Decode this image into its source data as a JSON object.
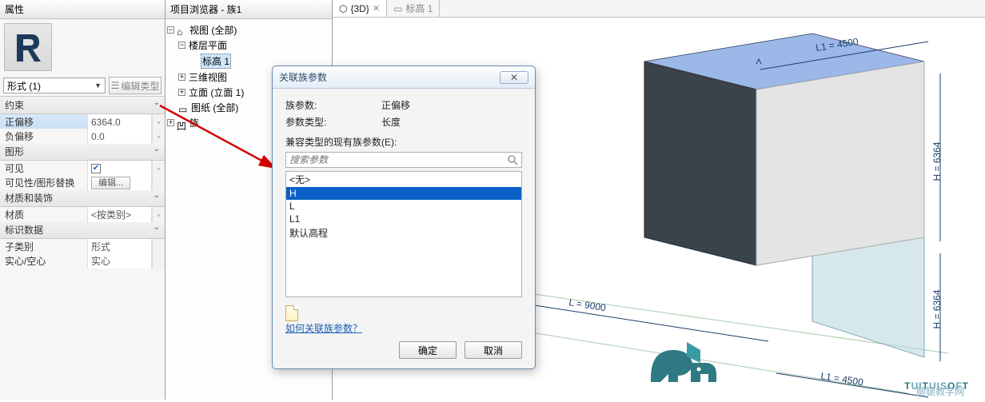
{
  "props": {
    "title": "属性",
    "type_selector": "形式 (1)",
    "edit_type": "编辑类型",
    "groups": {
      "constraint": "约束",
      "graphics": "图形",
      "material": "材质和装饰",
      "identity": "标识数据"
    },
    "rows": {
      "pos_offset_l": "正偏移",
      "pos_offset_v": "6364.0",
      "neg_offset_l": "负偏移",
      "neg_offset_v": "0.0",
      "visible_l": "可见",
      "override_l": "可见性/图形替换",
      "override_v": "编辑...",
      "material_l": "材质",
      "material_v": "<按类别>",
      "subcat_l": "子类别",
      "subcat_v": "形式",
      "solid_l": "实心/空心",
      "solid_v": "实心"
    }
  },
  "browser": {
    "title": "项目浏览器 - 族1",
    "items": {
      "views": "视图 (全部)",
      "floor": "楼层平面",
      "level1": "标高 1",
      "threeD": "三维视图",
      "elev": "立面 (立面 1)",
      "sheets": "图纸 (全部)",
      "family": "族"
    }
  },
  "tabs": {
    "t1": "{3D}",
    "t2": "标高 1"
  },
  "dialog": {
    "title": "关联族参数",
    "row1_l": "族参数:",
    "row1_v": "正偏移",
    "row2_l": "参数类型:",
    "row2_v": "长度",
    "list_label": "兼容类型的现有族参数(E):",
    "search_ph": "搜索参数",
    "items": {
      "none": "<无>",
      "h": "H",
      "l": "L",
      "l1": "L1",
      "elev": "默认高程"
    },
    "help": "如何关联族参数？",
    "ok": "确定",
    "cancel": "取消"
  },
  "dims": {
    "l1_top": "L1 = 4500",
    "l_bottom": "L = 9000",
    "h_right1": "H = 6364",
    "h_right2": "H = 6364",
    "l1_bottom": "L1 = 4500"
  },
  "watermark": {
    "brand": "TUITUISOFT",
    "sub": "腿腿教学网"
  }
}
